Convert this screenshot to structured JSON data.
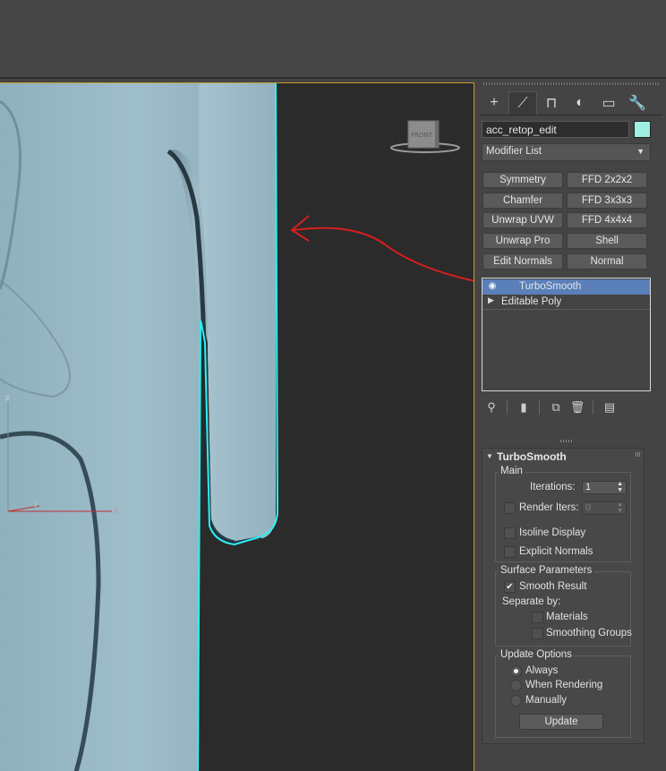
{
  "command_tabs": [
    {
      "icon": "plus-icon",
      "glyph": "+"
    },
    {
      "icon": "modify-icon",
      "glyph": "⟋"
    },
    {
      "icon": "hierarchy-icon",
      "glyph": "⊓"
    },
    {
      "icon": "motion-icon",
      "glyph": "◐"
    },
    {
      "icon": "display-icon",
      "glyph": "▭"
    },
    {
      "icon": "utilities-icon",
      "glyph": "🔧"
    }
  ],
  "object": {
    "name": "acc_retop_edit",
    "color": "#9ef0e2"
  },
  "modifier_list": {
    "label": "Modifier List"
  },
  "modifier_buttons": [
    "Symmetry",
    "FFD 2x2x2",
    "Chamfer",
    "FFD 3x3x3",
    "Unwrap UVW",
    "FFD 4x4x4",
    "Unwrap Pro",
    "Shell",
    "Edit Normals",
    "Normal"
  ],
  "stack": [
    {
      "label": "TurboSmooth",
      "selected": true
    },
    {
      "label": "Editable Poly",
      "selected": false
    }
  ],
  "viewcube": {
    "face_label": "FRONT"
  },
  "axis": {
    "x": "x",
    "y": "y",
    "z": "z"
  },
  "turbosmooth": {
    "title": "TurboSmooth",
    "main": {
      "title": "Main",
      "iterations_label": "Iterations:",
      "iterations_value": "1",
      "render_iters_label": "Render Iters:",
      "render_iters_value": "0",
      "isoline_label": "Isoline Display",
      "explicit_normals_label": "Explicit Normals"
    },
    "surface": {
      "title": "Surface Parameters",
      "smooth_result_label": "Smooth Result",
      "separate_by_label": "Separate by:",
      "materials_label": "Materials",
      "smoothing_groups_label": "Smoothing Groups"
    },
    "update": {
      "title": "Update Options",
      "always_label": "Always",
      "when_rendering_label": "When Rendering",
      "manually_label": "Manually",
      "update_button": "Update"
    }
  }
}
